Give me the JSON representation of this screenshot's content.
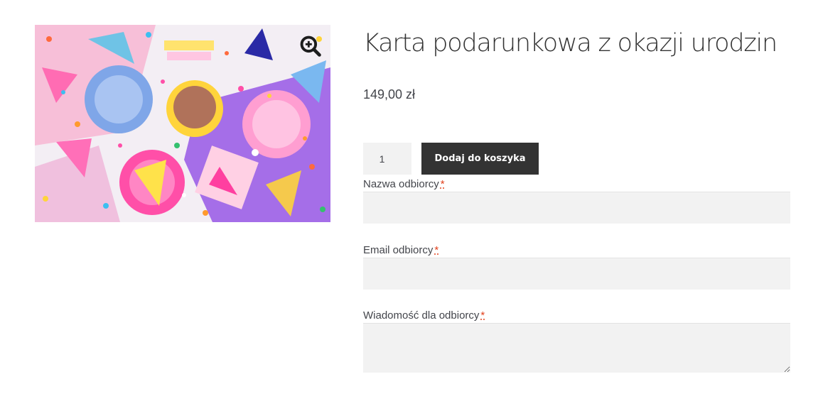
{
  "product": {
    "title": "Karta podarunkowa z okazji urodzin",
    "price": "149,00 zł",
    "image_alt": "Birthday party decorations: party hats, cupcake, colorful plates and confetti"
  },
  "cart": {
    "quantity": "1",
    "add_button": "Dodaj do koszyka"
  },
  "form": {
    "recipient_name_label": "Nazwa odbiorcy",
    "recipient_email_label": "Email odbiorcy",
    "message_label": "Wiadomość dla odbiorcy",
    "required_mark": "*",
    "recipient_name_value": "",
    "recipient_email_value": "",
    "message_value": ""
  },
  "icons": {
    "zoom": "zoom-in-icon"
  },
  "colors": {
    "button_bg": "#333333",
    "field_bg": "#f2f2f2",
    "required": "#e2401c"
  }
}
